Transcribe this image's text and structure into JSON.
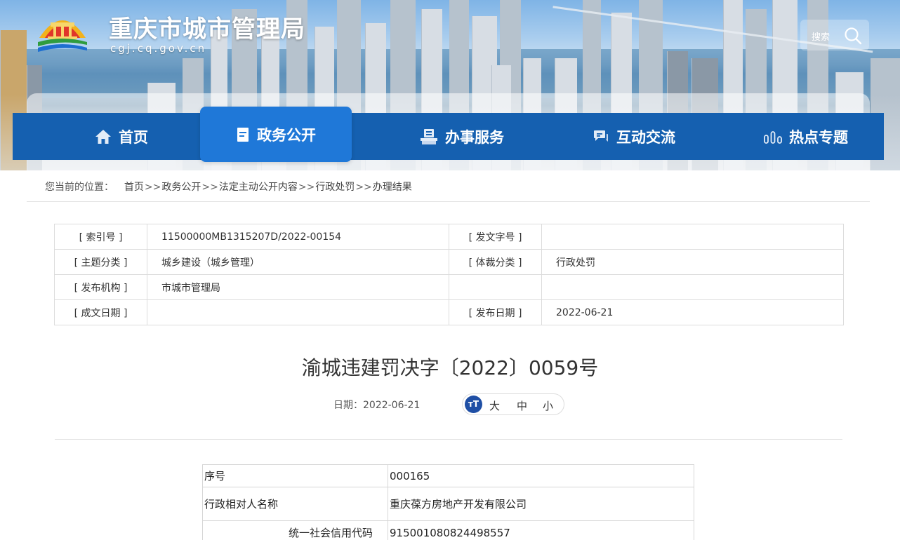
{
  "header": {
    "site_title": "重庆市城市管理局",
    "site_domain": "cgj.cq.gov.cn",
    "search_label": "搜索"
  },
  "nav": {
    "items": [
      {
        "label": "首页",
        "icon": "home-icon"
      },
      {
        "label": "政务公开",
        "icon": "document-icon",
        "active": true
      },
      {
        "label": "办事服务",
        "icon": "service-desk-icon"
      },
      {
        "label": "互动交流",
        "icon": "chat-icon"
      },
      {
        "label": "热点专题",
        "icon": "hot-topics-icon"
      }
    ],
    "bar_color": "#1560b0",
    "active_color": "#1f78d8"
  },
  "breadcrumb": {
    "prefix": "您当前的位置：",
    "items": [
      "首页",
      "政务公开",
      "法定主动公开内容",
      "行政处罚",
      "办理结果"
    ],
    "separator": ">>"
  },
  "meta": {
    "index_no_label": "[ 索引号 ]",
    "index_no": "11500000MB1315207D/2022-00154",
    "doc_no_label": "[ 发文字号 ]",
    "doc_no": "",
    "subject_label": "[ 主题分类 ]",
    "subject": "城乡建设（城乡管理）",
    "genre_label": "[ 体裁分类 ]",
    "genre": "行政处罚",
    "publisher_label": "[ 发布机构 ]",
    "publisher": "市城市管理局",
    "created_label": "[ 成文日期 ]",
    "created": "",
    "published_label": "[ 发布日期 ]",
    "published": "2022-06-21"
  },
  "article": {
    "title": "渝城违建罚决字〔2022〕0059号",
    "date_text": "日期：2022-06-21",
    "font_sizes": [
      "大",
      "中",
      "小"
    ],
    "font_icon_text": "тT"
  },
  "content_table": {
    "rows": [
      {
        "key": "序号",
        "value": "000165"
      },
      {
        "key": "行政相对人名称",
        "value": "重庆葆方房地产开发有限公司"
      },
      {
        "key": "统一社会信用代码",
        "value": "915001080824498557"
      }
    ]
  }
}
